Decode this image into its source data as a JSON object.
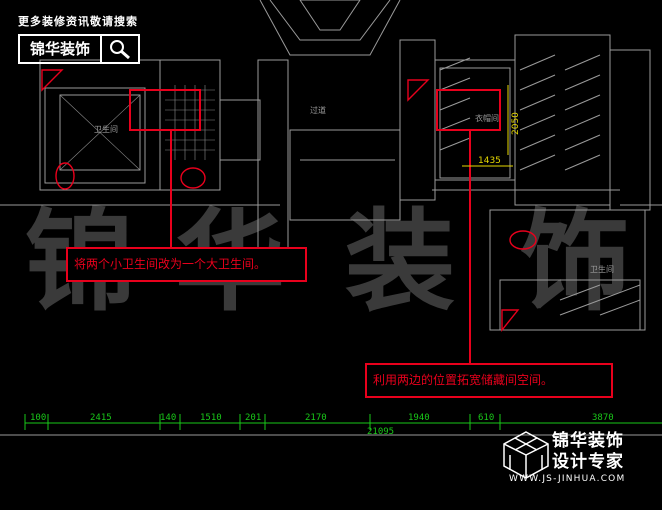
{
  "header": {
    "banner": "更多装修资讯敬请搜索",
    "logo_text": "锦华装饰",
    "search_icon": "magnifier-icon"
  },
  "watermark": "锦 华 装 饰",
  "rooms": {
    "left_bath": "卫生间",
    "corridor": "过道",
    "right_room": "衣帽间",
    "small_room": "卫生间"
  },
  "dimensions_vertical": "2050",
  "dimensions_horizontal": "1435",
  "callouts": [
    "将两个小卫生间改为一个大卫生间。",
    "利用两边的位置拓宽储藏间空间。"
  ],
  "dim_row": [
    "100",
    "2415",
    "140",
    "1510",
    "201",
    "2170",
    "1940",
    "610",
    "3870"
  ],
  "dim_total": "21095",
  "brand": {
    "line1": "锦华装饰",
    "line2": "设计专家",
    "url": "WWW.JS-JINHUA.COM"
  },
  "colors": {
    "line": "#9a9a9a",
    "red": "#e8001c",
    "green": "#19c819",
    "yellow": "#e6d800"
  }
}
